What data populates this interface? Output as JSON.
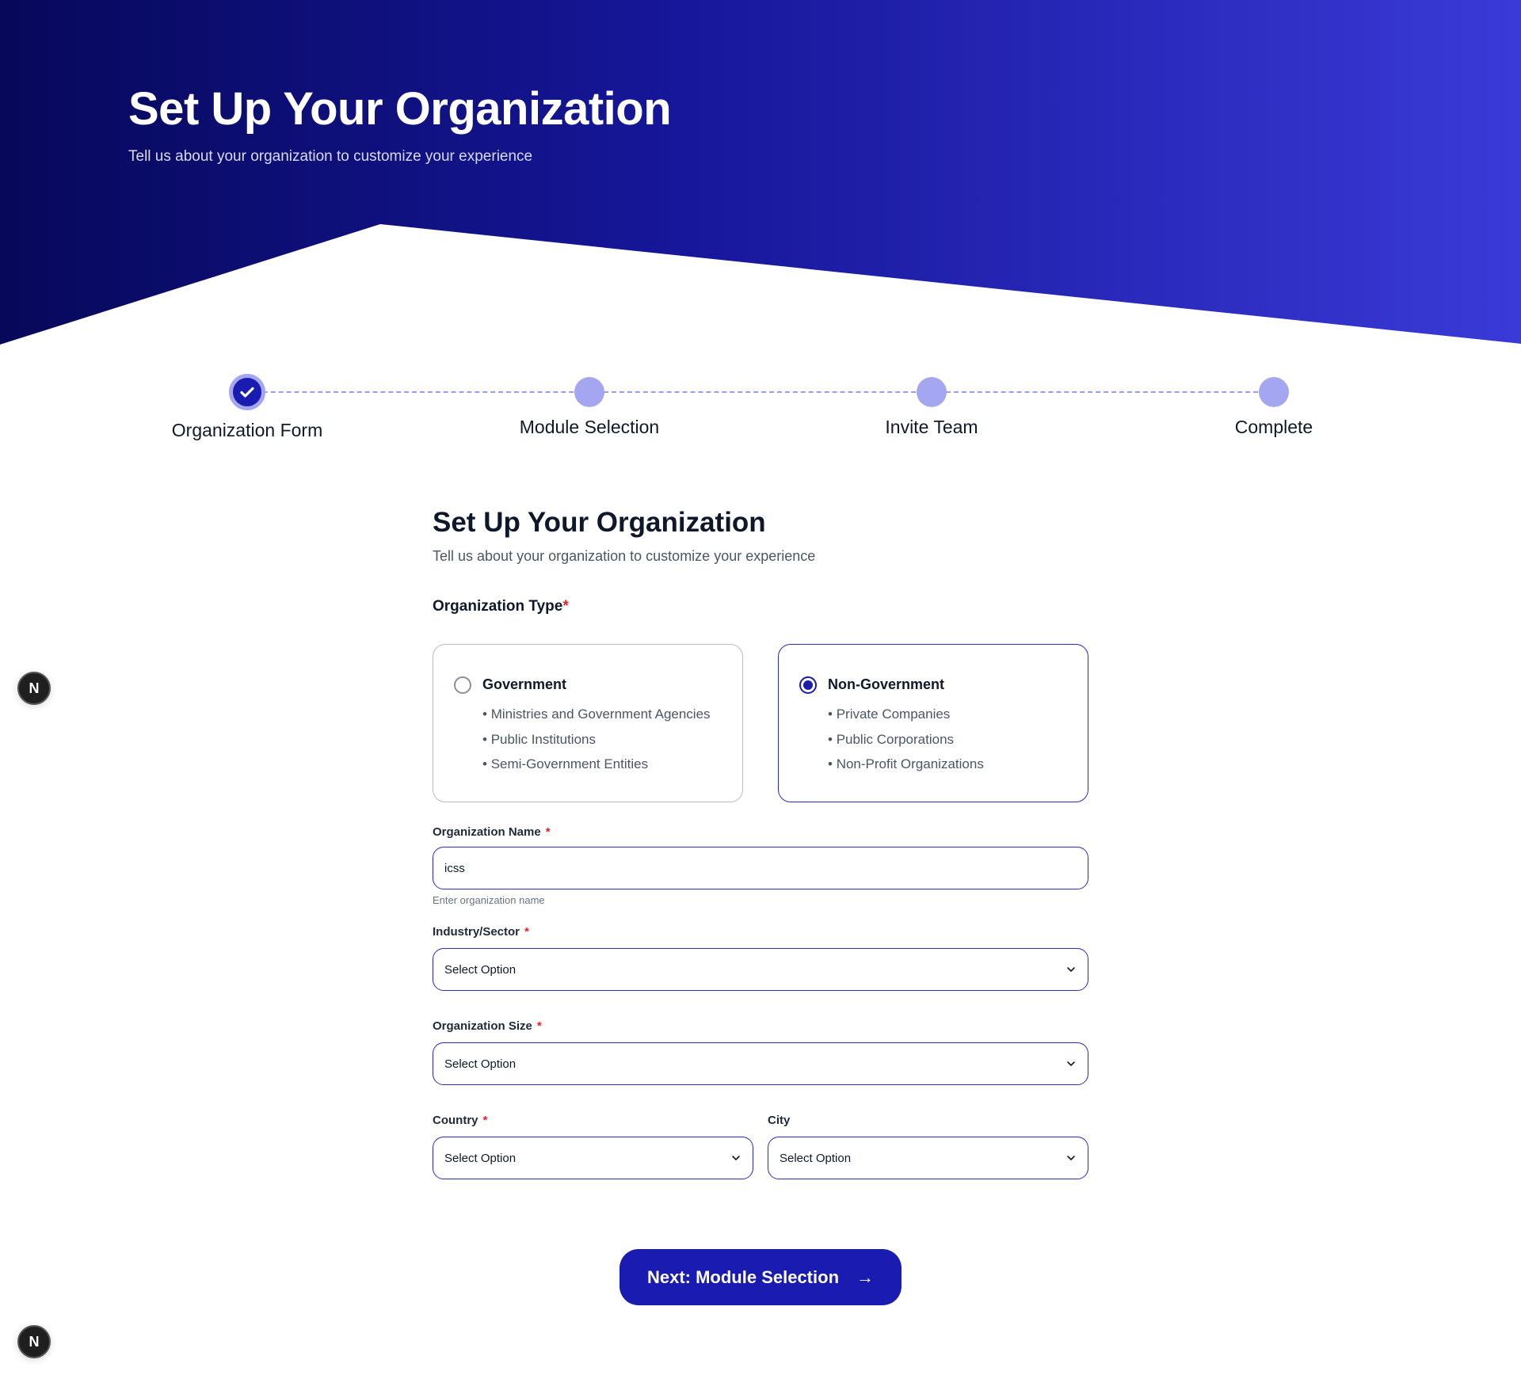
{
  "hero": {
    "title": "Set Up Your Organization",
    "subtitle": "Tell us about your organization to customize your experience"
  },
  "stepper": {
    "steps": [
      {
        "label": "Organization Form",
        "state": "completed"
      },
      {
        "label": "Module Selection",
        "state": "upcoming"
      },
      {
        "label": "Invite Team",
        "state": "upcoming"
      },
      {
        "label": "Complete",
        "state": "upcoming"
      }
    ]
  },
  "form": {
    "title": "Set Up Your Organization",
    "subtitle": "Tell us about your organization to customize your experience",
    "org_type": {
      "label": "Organization Type",
      "required_mark": "*",
      "options": [
        {
          "title": "Government",
          "selected": false,
          "items": [
            "Ministries and Government Agencies",
            "Public Institutions",
            "Semi-Government Entities"
          ]
        },
        {
          "title": "Non-Government",
          "selected": true,
          "items": [
            "Private Companies",
            "Public Corporations",
            "Non-Profit Organizations"
          ]
        }
      ]
    },
    "org_name": {
      "label": "Organization Name",
      "required_mark": "*",
      "value": "icss",
      "helper": "Enter organization name"
    },
    "industry": {
      "label": "Industry/Sector",
      "required_mark": "*",
      "value": "Select Option"
    },
    "size": {
      "label": "Organization Size",
      "required_mark": "*",
      "value": "Select Option"
    },
    "country": {
      "label": "Country",
      "required_mark": "*",
      "value": "Select Option"
    },
    "city": {
      "label": "City",
      "value": "Select Option"
    }
  },
  "next_button": {
    "label": "Next: Module Selection",
    "arrow": "→"
  },
  "badge": {
    "letter": "N"
  },
  "colors": {
    "primary": "#1a1bb0",
    "hero_start": "#07085a",
    "hero_end": "#3a3ad8",
    "step_inactive": "#a5a6f2",
    "required": "#dc2626"
  }
}
